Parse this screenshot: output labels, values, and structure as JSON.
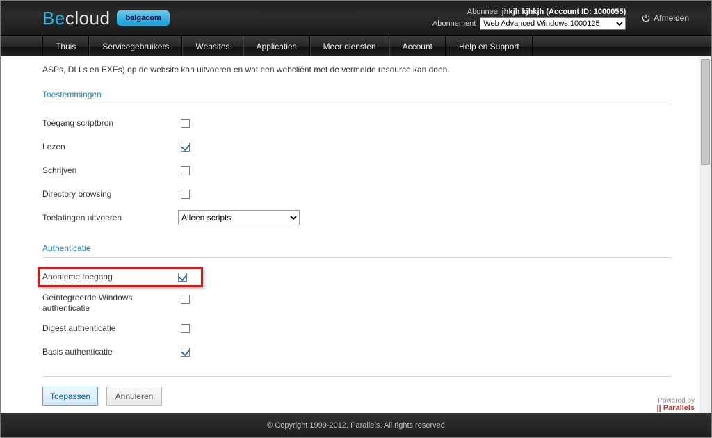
{
  "brand": {
    "part1": "Be",
    "part2": "cloud",
    "badge": "belgacom"
  },
  "header": {
    "subscriber_label": "Abonnee",
    "subscriber_value": "jhkjh kjhkjh (Account ID: 1000055)",
    "subscription_label": "Abonnement",
    "subscription_selected": "Web Advanced Windows:1000125",
    "logout": "Afmelden"
  },
  "nav": [
    "Thuis",
    "Servicegebruikers",
    "Websites",
    "Applicaties",
    "Meer diensten",
    "Account",
    "Help en Support"
  ],
  "intro_fragment": "ASPs, DLLs en EXEs) op de website kan uitvoeren en wat een webcliënt met de vermelde resource kan doen.",
  "section_permissions": "Toestemmingen",
  "permissions": {
    "script_source": {
      "label": "Toegang scriptbron",
      "checked": false
    },
    "read": {
      "label": "Lezen",
      "checked": true
    },
    "write": {
      "label": "Schrijven",
      "checked": false
    },
    "dirbrowse": {
      "label": "Directory browsing",
      "checked": false
    },
    "exec": {
      "label": "Toelatingen uitvoeren",
      "selected": "Alleen scripts"
    }
  },
  "section_auth": "Authenticatie",
  "auth": {
    "anon": {
      "label": "Anonieme toegang",
      "checked": true
    },
    "winint": {
      "label": "Geïntegreerde Windows authenticatie",
      "checked": false
    },
    "digest": {
      "label": "Digest authenticatie",
      "checked": false
    },
    "basic": {
      "label": "Basis authenticatie",
      "checked": true
    }
  },
  "buttons": {
    "apply": "Toepassen",
    "cancel": "Annuleren"
  },
  "powered": {
    "top": "Powered by",
    "bottom": "|| Parallels"
  },
  "footer": "© Copyright 1999-2012, Parallels. All rights reserved"
}
